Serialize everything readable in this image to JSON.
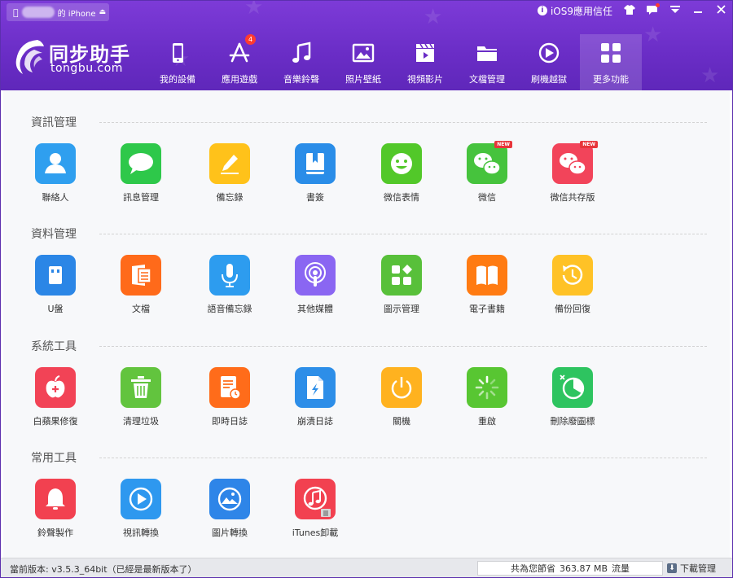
{
  "titlebar": {
    "device_name": "的 iPhone",
    "trust_label": "iOS9應用信任",
    "controls": [
      "shirt-icon",
      "message-icon",
      "dropdown-icon",
      "minimize-icon",
      "close-icon"
    ]
  },
  "logo": {
    "brand": "同步助手",
    "domain": "tongbu.com"
  },
  "nav": [
    {
      "label": "我的設備",
      "icon": "phone-icon"
    },
    {
      "label": "應用遊戲",
      "icon": "appstore-icon",
      "badge": "4"
    },
    {
      "label": "音樂鈴聲",
      "icon": "music-icon"
    },
    {
      "label": "照片壁紙",
      "icon": "photo-icon"
    },
    {
      "label": "視頻影片",
      "icon": "video-icon"
    },
    {
      "label": "文檔管理",
      "icon": "folder-icon"
    },
    {
      "label": "刷機越獄",
      "icon": "flash-icon"
    },
    {
      "label": "更多功能",
      "icon": "grid-icon",
      "active": true
    }
  ],
  "sections": [
    {
      "title": "資訊管理",
      "items": [
        {
          "label": "聯絡人",
          "icon": "contacts-icon",
          "color": "#2f9fef"
        },
        {
          "label": "訊息管理",
          "icon": "message-bubble-icon",
          "color": "#2ec84a"
        },
        {
          "label": "備忘錄",
          "icon": "notes-icon",
          "color": "#ffc21a"
        },
        {
          "label": "書簽",
          "icon": "bookmark-icon",
          "color": "#2a8de8"
        },
        {
          "label": "微信表情",
          "icon": "smiley-icon",
          "color": "#52c829"
        },
        {
          "label": "微信",
          "icon": "wechat-icon",
          "color": "#46c33d",
          "badge": "NEW"
        },
        {
          "label": "微信共存版",
          "icon": "wechat-icon",
          "color": "#f2445a",
          "badge": "NEW"
        }
      ]
    },
    {
      "title": "資料管理",
      "items": [
        {
          "label": "U盤",
          "icon": "usb-icon",
          "color": "#2b86e6"
        },
        {
          "label": "文檔",
          "icon": "document-icon",
          "color": "#ff6a1a"
        },
        {
          "label": "語音備忘錄",
          "icon": "microphone-icon",
          "color": "#2d9cef"
        },
        {
          "label": "其他媒體",
          "icon": "podcast-icon",
          "color": "#8a66f2"
        },
        {
          "label": "圖示管理",
          "icon": "apps-icon",
          "color": "#58c03a"
        },
        {
          "label": "電子書籍",
          "icon": "book-icon",
          "color": "#ff7b12"
        },
        {
          "label": "備份回復",
          "icon": "restore-icon",
          "color": "#ffc226"
        }
      ]
    },
    {
      "title": "系統工具",
      "items": [
        {
          "label": "白蘋果修復",
          "icon": "apple-repair-icon",
          "color": "#f24356"
        },
        {
          "label": "清理垃圾",
          "icon": "trash-icon",
          "color": "#62c43e"
        },
        {
          "label": "即時日誌",
          "icon": "log-icon",
          "color": "#ff6c1a"
        },
        {
          "label": "崩潰日誌",
          "icon": "crash-log-icon",
          "color": "#2d8ee8"
        },
        {
          "label": "關機",
          "icon": "power-icon",
          "color": "#ffb21f"
        },
        {
          "label": "重啟",
          "icon": "spinner-icon",
          "color": "#58c632"
        },
        {
          "label": "刪除廢圖標",
          "icon": "pie-icon",
          "color": "#2ec460"
        }
      ]
    },
    {
      "title": "常用工具",
      "items": [
        {
          "label": "鈴聲製作",
          "icon": "bell-icon",
          "color": "#f24150"
        },
        {
          "label": "視訊轉換",
          "icon": "play-icon",
          "color": "#2e98ef"
        },
        {
          "label": "圖片轉換",
          "icon": "image-convert-icon",
          "color": "#2e85e8"
        },
        {
          "label": "iTunes卸載",
          "icon": "itunes-icon",
          "color": "#f24150"
        }
      ]
    }
  ],
  "statusbar": {
    "version": "當前版本: v3.5.3_64bit（已經是最新版本了）",
    "saved_prefix": "共為您節省",
    "saved_value": "363.87 MB",
    "saved_suffix": "流量",
    "downloads": "下載管理"
  }
}
